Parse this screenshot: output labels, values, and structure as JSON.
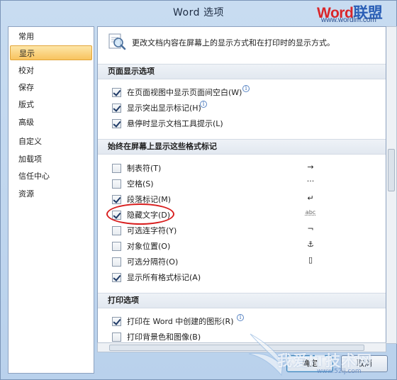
{
  "window": {
    "title": "Word 选项"
  },
  "logo": {
    "part1": "Word",
    "part2": "联盟",
    "url": "www.wordlm.com"
  },
  "sidebar": {
    "items": [
      {
        "label": "常用"
      },
      {
        "label": "显示",
        "active": true
      },
      {
        "label": "校对"
      },
      {
        "label": "保存"
      },
      {
        "label": "版式"
      },
      {
        "label": "高级"
      },
      {
        "label": "自定义"
      },
      {
        "label": "加载项"
      },
      {
        "label": "信任中心"
      },
      {
        "label": "资源"
      }
    ]
  },
  "banner": {
    "text": "更改文档内容在屏幕上的显示方式和在打印时的显示方式。",
    "icon": "magnifier-page-icon"
  },
  "sections": {
    "page_display": {
      "title": "页面显示选项",
      "options": [
        {
          "label": "在页面视图中显示页面间空白(W)",
          "checked": true,
          "info": "i"
        },
        {
          "label": "显示突出显示标记(H)",
          "checked": true,
          "info": "i"
        },
        {
          "label": "悬停时显示文档工具提示(L)",
          "checked": true
        }
      ]
    },
    "format_marks": {
      "title": "始终在屏幕上显示这些格式标记",
      "options": [
        {
          "label": "制表符(T)",
          "checked": false,
          "mark": "→"
        },
        {
          "label": "空格(S)",
          "checked": false,
          "mark": "···"
        },
        {
          "label": "段落标记(M)",
          "checked": true,
          "mark": "↵"
        },
        {
          "label": "隐藏文字(D)",
          "checked": true,
          "mark": "abc"
        },
        {
          "label": "可选连字符(Y)",
          "checked": false,
          "mark": "¬"
        },
        {
          "label": "对象位置(O)",
          "checked": false,
          "mark": "⚓"
        },
        {
          "label": "可选分隔符(O)",
          "checked": false,
          "mark": "▯"
        },
        {
          "label": "显示所有格式标记(A)",
          "checked": true
        }
      ]
    },
    "print": {
      "title": "打印选项",
      "options": [
        {
          "label": "打印在 Word 中创建的图形(R)",
          "checked": true,
          "info": "i"
        },
        {
          "label": "打印背景色和图像(B)",
          "checked": false
        }
      ]
    }
  },
  "buttons": {
    "ok": "确定",
    "cancel": "取消"
  },
  "watermark": {
    "text": "我爱IT技术网",
    "url": "www.52ij.com"
  },
  "colors": {
    "accent": "#f8c35f",
    "highlight_circle": "#d81e1e",
    "chrome": "#c8dcf1"
  }
}
